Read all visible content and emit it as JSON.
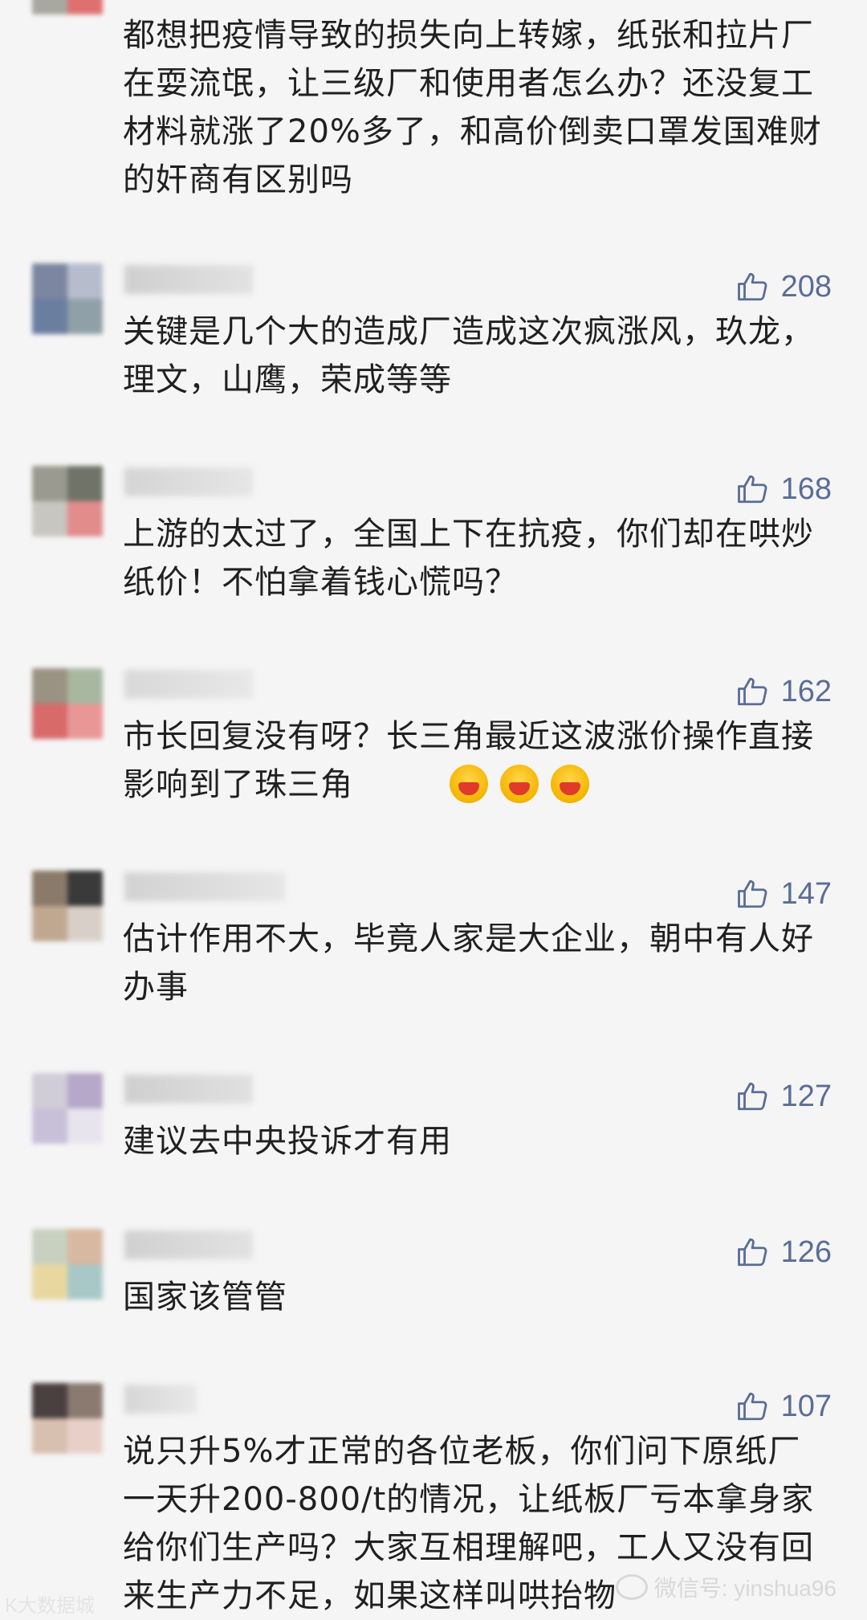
{
  "comments": [
    {
      "text": "都想把疫情导致的损失向上转嫁，纸张和拉片厂在耍流氓，让三级厂和使用者怎么办？还没复工材料就涨了20%多了，和高价倒卖口罩发国难财的奸商有区别吗",
      "likes": "",
      "name": ""
    },
    {
      "text": "关键是几个大的造成厂造成这次疯涨风，玖龙，理文，山鹰，荣成等等",
      "likes": "208",
      "name": ""
    },
    {
      "text": "上游的太过了，全国上下在抗疫，你们却在哄炒纸价！不怕拿着钱心慌吗？",
      "likes": "168",
      "name": ""
    },
    {
      "text": "市长回复没有呀？长三角最近这波涨价操作直接影响到了珠三角",
      "likes": "162",
      "name": ""
    },
    {
      "text": "估计作用不大，毕竟人家是大企业，朝中有人好办事",
      "likes": "147",
      "name": ""
    },
    {
      "text": "建议去中央投诉才有用",
      "likes": "127",
      "name": ""
    },
    {
      "text": "国家该管管",
      "likes": "126",
      "name": ""
    },
    {
      "text": "说只升5%才正常的各位老板，你们问下原纸厂一天升200-800/t的情况，让纸板厂亏本拿身家给你们生产吗？大家互相理解吧，工人又没有回来生产力不足，如果这样叫哄抬物",
      "likes": "107",
      "name": ""
    }
  ],
  "icons": {
    "like": "thumbs-up-icon",
    "emoji": "laughing-crying-emoji-icon"
  },
  "watermark": {
    "text": "微信号: yinshua96"
  },
  "logo_watermark": {
    "text": "K大数据城"
  },
  "colors": {
    "background": "#f5f5f5",
    "like_blue": "#596d96",
    "text": "#202020"
  }
}
